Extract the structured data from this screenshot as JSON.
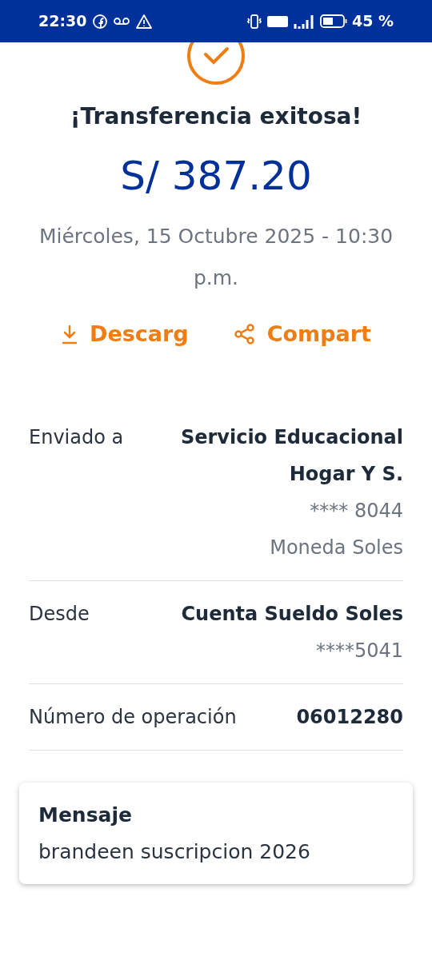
{
  "status_bar": {
    "time": "22:30",
    "battery": "45 %"
  },
  "result": {
    "title": "¡Transferencia exitosa!",
    "amount": "S/ 387.20",
    "date": "Miércoles, 15 Octubre 2025 - 10:30 p.m."
  },
  "actions": [
    {
      "kind": "download",
      "label": "Descarg"
    },
    {
      "kind": "share",
      "label": "Compart"
    }
  ],
  "details": [
    {
      "label": "Enviado a",
      "lines": [
        {
          "text": "Servicio Educacional",
          "bold": true
        },
        {
          "text": "Hogar Y S.",
          "bold": true
        },
        {
          "text": "**** 8044",
          "bold": false
        },
        {
          "text": "Moneda Soles",
          "bold": false
        }
      ]
    },
    {
      "label": "Desde",
      "lines": [
        {
          "text": "Cuenta Sueldo Soles",
          "bold": true
        },
        {
          "text": "****5041",
          "bold": false
        }
      ]
    },
    {
      "label": "Número de operación",
      "lines": [
        {
          "text": "06012280",
          "bold": true
        }
      ]
    }
  ],
  "message": {
    "title": "Mensaje",
    "text": "brandeen suscripcion 2026"
  }
}
